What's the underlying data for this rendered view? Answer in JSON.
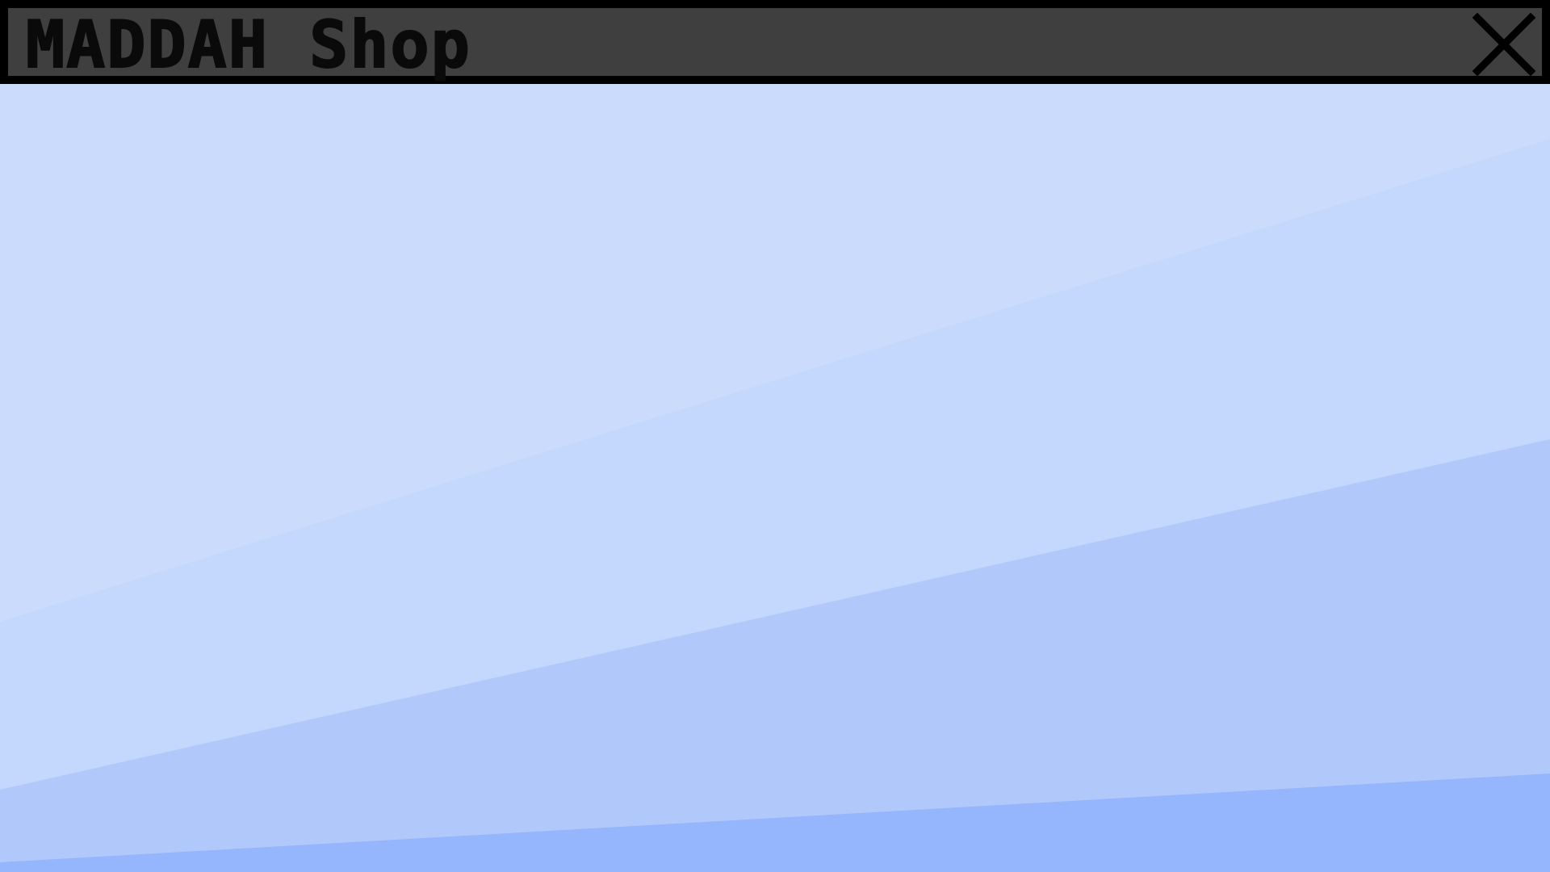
{
  "window": {
    "title": "MADDAH Shop",
    "close_icon": "close-icon"
  },
  "colors": {
    "titlebar_bg": "#3f3f3f",
    "titlebar_border": "#000000",
    "title_text": "#0a0a0a",
    "band_1": "#cbdbfb",
    "band_2": "#c4d7fd",
    "band_3": "#b1c9fa",
    "band_4": "#95b6fc"
  }
}
